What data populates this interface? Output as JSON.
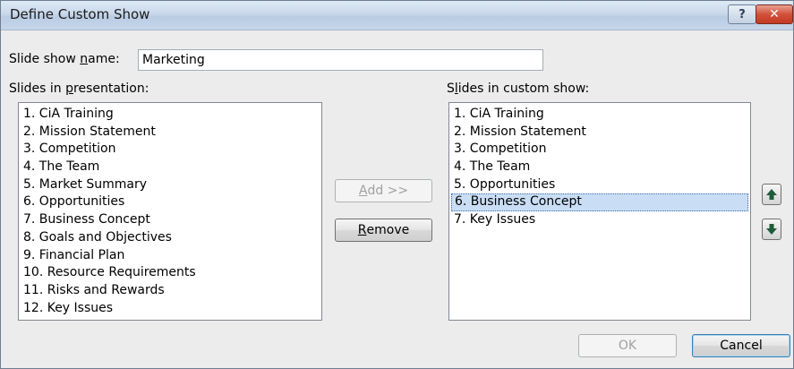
{
  "window": {
    "title": "Define Custom Show",
    "help_label": "?",
    "close_label": "✕"
  },
  "name_field": {
    "label_pre": "Slide show ",
    "label_accel": "n",
    "label_post": "ame:",
    "value": "Marketing"
  },
  "presentation_list": {
    "label_pre": "Slides in ",
    "label_accel": "p",
    "label_post": "resentation:",
    "items": [
      "1. CiA Training",
      "2. Mission Statement",
      "3. Competition",
      "4. The Team",
      "5. Market Summary",
      "6. Opportunities",
      "7. Business Concept",
      "8. Goals and Objectives",
      "9. Financial Plan",
      "10. Resource Requirements",
      "11. Risks and Rewards",
      "12. Key Issues"
    ]
  },
  "custom_list": {
    "label_pre": "S",
    "label_accel": "l",
    "label_post": "ides in custom show:",
    "items": [
      "1. CiA Training",
      "2. Mission Statement",
      "3. Competition",
      "4. The Team",
      "5. Opportunities",
      "6. Business Concept",
      "7. Key Issues"
    ],
    "selected_index": 5
  },
  "buttons": {
    "add_accel": "A",
    "add_rest": "dd >>",
    "remove_accel": "R",
    "remove_rest": "emove",
    "ok": "OK",
    "cancel": "Cancel"
  },
  "icons": {
    "move_up": "arrow-up-icon",
    "move_down": "arrow-down-icon"
  },
  "colors": {
    "selection": "#c9def5",
    "arrow_green": "#1f5c3a"
  }
}
